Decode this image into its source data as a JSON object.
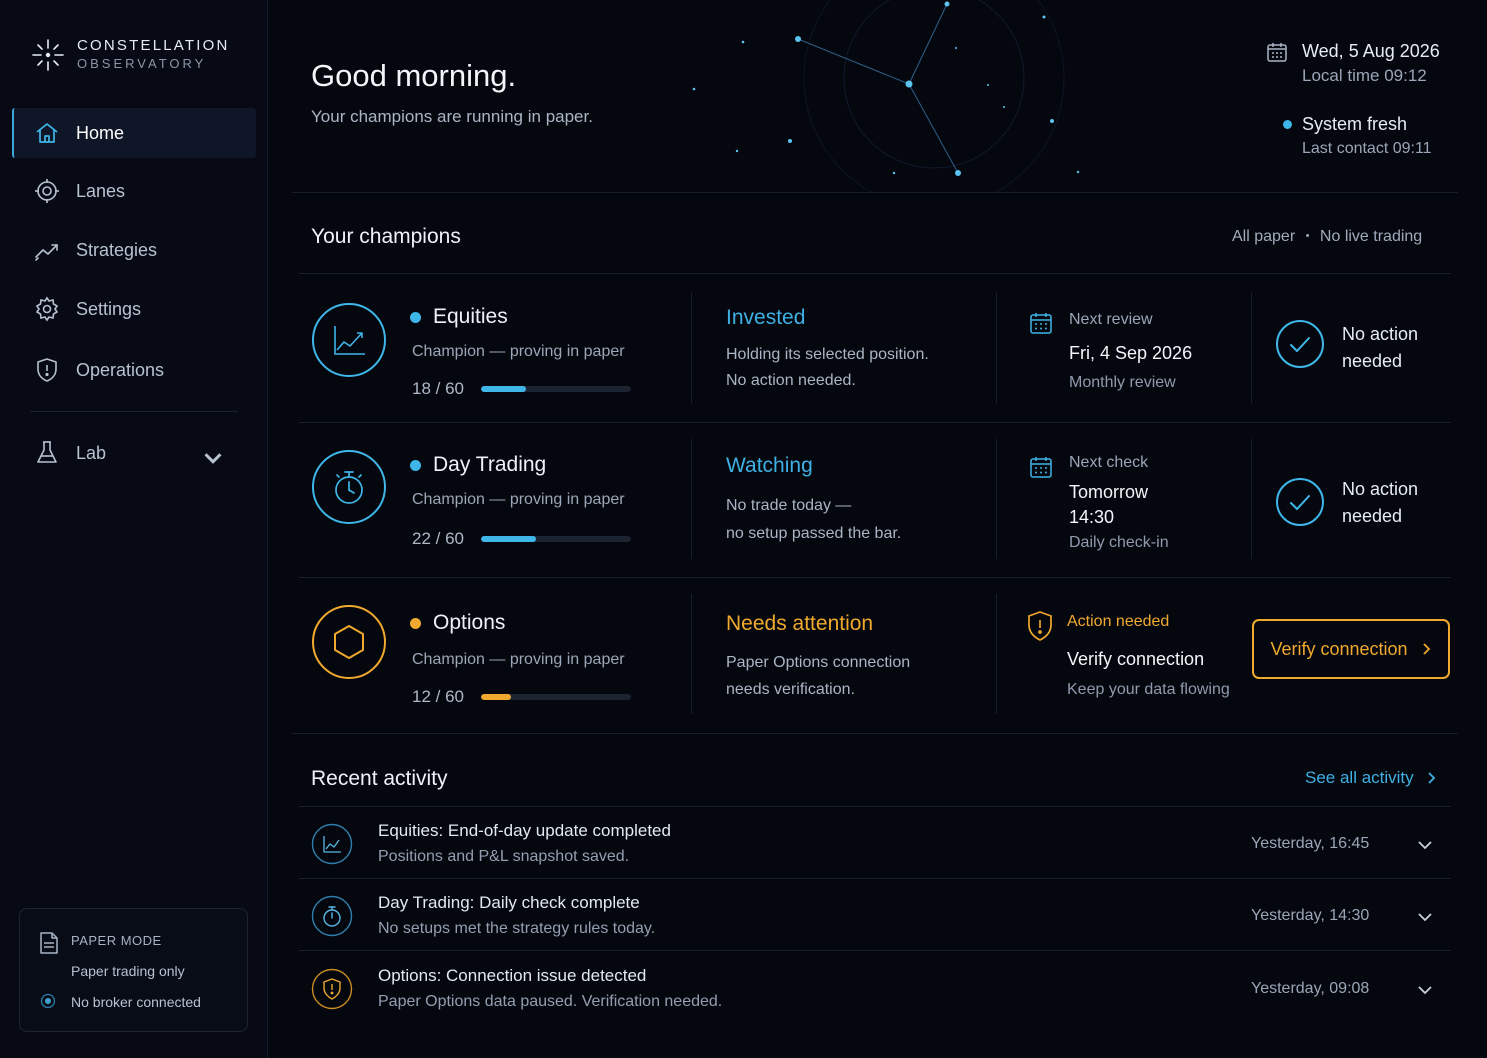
{
  "brand": {
    "title": "CONSTELLATION",
    "subtitle": "OBSERVATORY"
  },
  "nav": {
    "items": [
      {
        "label": "Home",
        "icon": "home-icon",
        "active": true
      },
      {
        "label": "Lanes",
        "icon": "target-icon"
      },
      {
        "label": "Strategies",
        "icon": "trend-icon"
      },
      {
        "label": "Settings",
        "icon": "gear-icon"
      },
      {
        "label": "Operations",
        "icon": "shield-icon"
      }
    ],
    "lab": {
      "label": "Lab",
      "icon": "flask-icon"
    }
  },
  "paper_mode": {
    "title": "PAPER MODE",
    "line1": "Paper trading only",
    "line2": "No broker connected"
  },
  "header": {
    "greeting": "Good morning.",
    "subtitle": "Your champions are running in paper.",
    "date": "Wed, 5 Aug 2026",
    "local_time": "Local time 09:12",
    "system_status": "System fresh",
    "last_contact": "Last contact 09:11"
  },
  "champions": {
    "title": "Your champions",
    "meta_left": "All paper",
    "meta_sep": "•",
    "meta_right": "No live trading",
    "rows": [
      {
        "name": "Equities",
        "subtitle": "Champion — proving in paper",
        "progress_text": "18 / 60",
        "progress": 0.3,
        "accent": "#3fb6e8",
        "status_title": "Invested",
        "status_line1": "Holding its selected position.",
        "status_line2": "No action needed.",
        "review_label": "Next review",
        "review_date": "Fri, 4 Sep 2026",
        "review_sub": "Monthly review",
        "action_line1": "No action",
        "action_line2": "needed"
      },
      {
        "name": "Day Trading",
        "subtitle": "Champion — proving in paper",
        "progress_text": "22 / 60",
        "progress": 0.367,
        "accent": "#3fb6e8",
        "status_title": "Watching",
        "status_line1": "No trade today —",
        "status_line2": "no setup passed the bar.",
        "review_label": "Next check",
        "review_date_line1": "Tomorrow",
        "review_date_line2": "14:30",
        "review_sub": "Daily check-in",
        "action_line1": "No action",
        "action_line2": "needed"
      },
      {
        "name": "Options",
        "subtitle": "Champion — proving in paper",
        "progress_text": "12 / 60",
        "progress": 0.2,
        "accent": "#f0a92d",
        "status_title": "Needs attention",
        "status_line1": "Paper Options connection",
        "status_line2": "needs verification.",
        "review_label": "Action needed",
        "review_date": "Verify connection",
        "review_sub": "Keep your data flowing",
        "button_label": "Verify connection"
      }
    ]
  },
  "activity": {
    "title": "Recent activity",
    "see_all": "See all activity",
    "items": [
      {
        "title": "Equities: End-of-day update completed",
        "subtitle": "Positions and P&L snapshot saved.",
        "time": "Yesterday, 16:45",
        "icon": "chart-icon"
      },
      {
        "title": "Day Trading: Daily check complete",
        "subtitle": "No setups met the strategy rules today.",
        "time": "Yesterday, 14:30",
        "icon": "stopwatch-icon"
      },
      {
        "title": "Options: Connection issue detected",
        "subtitle": "Paper Options data paused. Verification needed.",
        "time": "Yesterday, 09:08",
        "icon": "shield-alert-icon"
      }
    ]
  },
  "colors": {
    "accent_blue": "#3fb6e8",
    "accent_amber": "#f0a92d",
    "background": "#05070f"
  }
}
